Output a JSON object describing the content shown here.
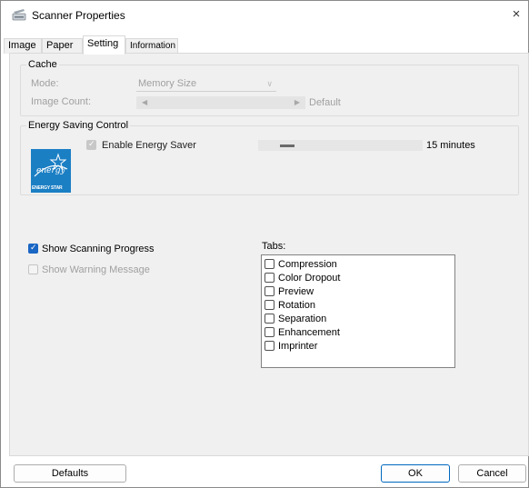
{
  "window": {
    "title": "Scanner Properties",
    "close_glyph": "×",
    "icon": "scanner-icon"
  },
  "tabs": [
    {
      "label": "Image"
    },
    {
      "label": "Paper"
    },
    {
      "label": "Setting"
    },
    {
      "label": "Information"
    }
  ],
  "active_tab": "Setting",
  "cache": {
    "title": "Cache",
    "mode_label": "Mode:",
    "mode_value": "Memory Size",
    "image_count_label": "Image Count:",
    "image_count_value": "Default"
  },
  "energy": {
    "title": "Energy Saving Control",
    "enable_label": "Enable Energy Saver",
    "enable_checked": true,
    "time_value": "15 minutes",
    "logo_text": "ENERGY STAR",
    "logo_script": "energy"
  },
  "options": {
    "show_progress_label": "Show Scanning Progress",
    "show_progress_checked": true,
    "show_warning_label": "Show Warning Message",
    "show_warning_checked": false
  },
  "tabs_list": {
    "label": "Tabs:",
    "items": [
      {
        "label": "Compression",
        "checked": false
      },
      {
        "label": "Color Dropout",
        "checked": false
      },
      {
        "label": "Preview",
        "checked": false
      },
      {
        "label": "Rotation",
        "checked": false
      },
      {
        "label": "Separation",
        "checked": false
      },
      {
        "label": "Enhancement",
        "checked": false
      },
      {
        "label": "Imprinter",
        "checked": false
      }
    ]
  },
  "buttons": {
    "defaults": "Defaults",
    "ok": "OK",
    "cancel": "Cancel"
  },
  "colors": {
    "accent": "#1a66c4",
    "energy_star": "#1b7fc4",
    "panel_bg": "#f0f0f0"
  }
}
